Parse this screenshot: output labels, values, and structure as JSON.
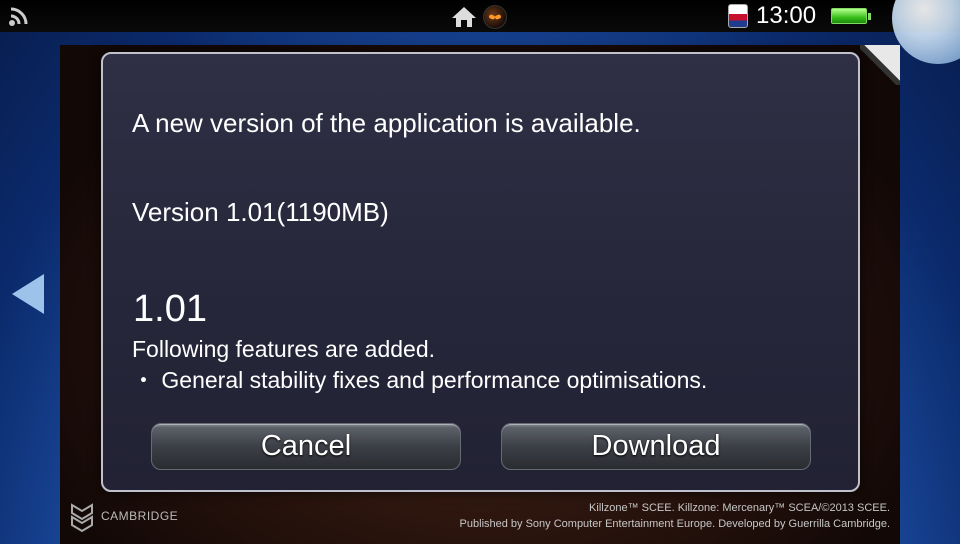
{
  "statusbar": {
    "time": "13:00"
  },
  "dialog": {
    "headline": "A new version of the application is available.",
    "version_line": "Version 1.01(1190MB)",
    "version_number": "1.01",
    "notes_intro": "Following features are added.",
    "notes_item": "・ General stability fixes and performance optimisations.",
    "cancel_label": "Cancel",
    "download_label": "Download"
  },
  "livearea": {
    "brand": "CAMBRIDGE",
    "copyright_line1": "Killzone™ SCEE. Killzone: Mercenary™ SCEA/©2013 SCEE.",
    "copyright_line2": "Published by Sony Computer Entertainment Europe. Developed by Guerrilla Cambridge."
  },
  "colors": {
    "dialog_bg": "#26263a",
    "dialog_border": "#bfc2cc",
    "battery": "#39c01b"
  },
  "icons": [
    "wifi-icon",
    "home-icon",
    "app-icon",
    "notification-icon",
    "battery-icon",
    "left-arrow-icon"
  ]
}
